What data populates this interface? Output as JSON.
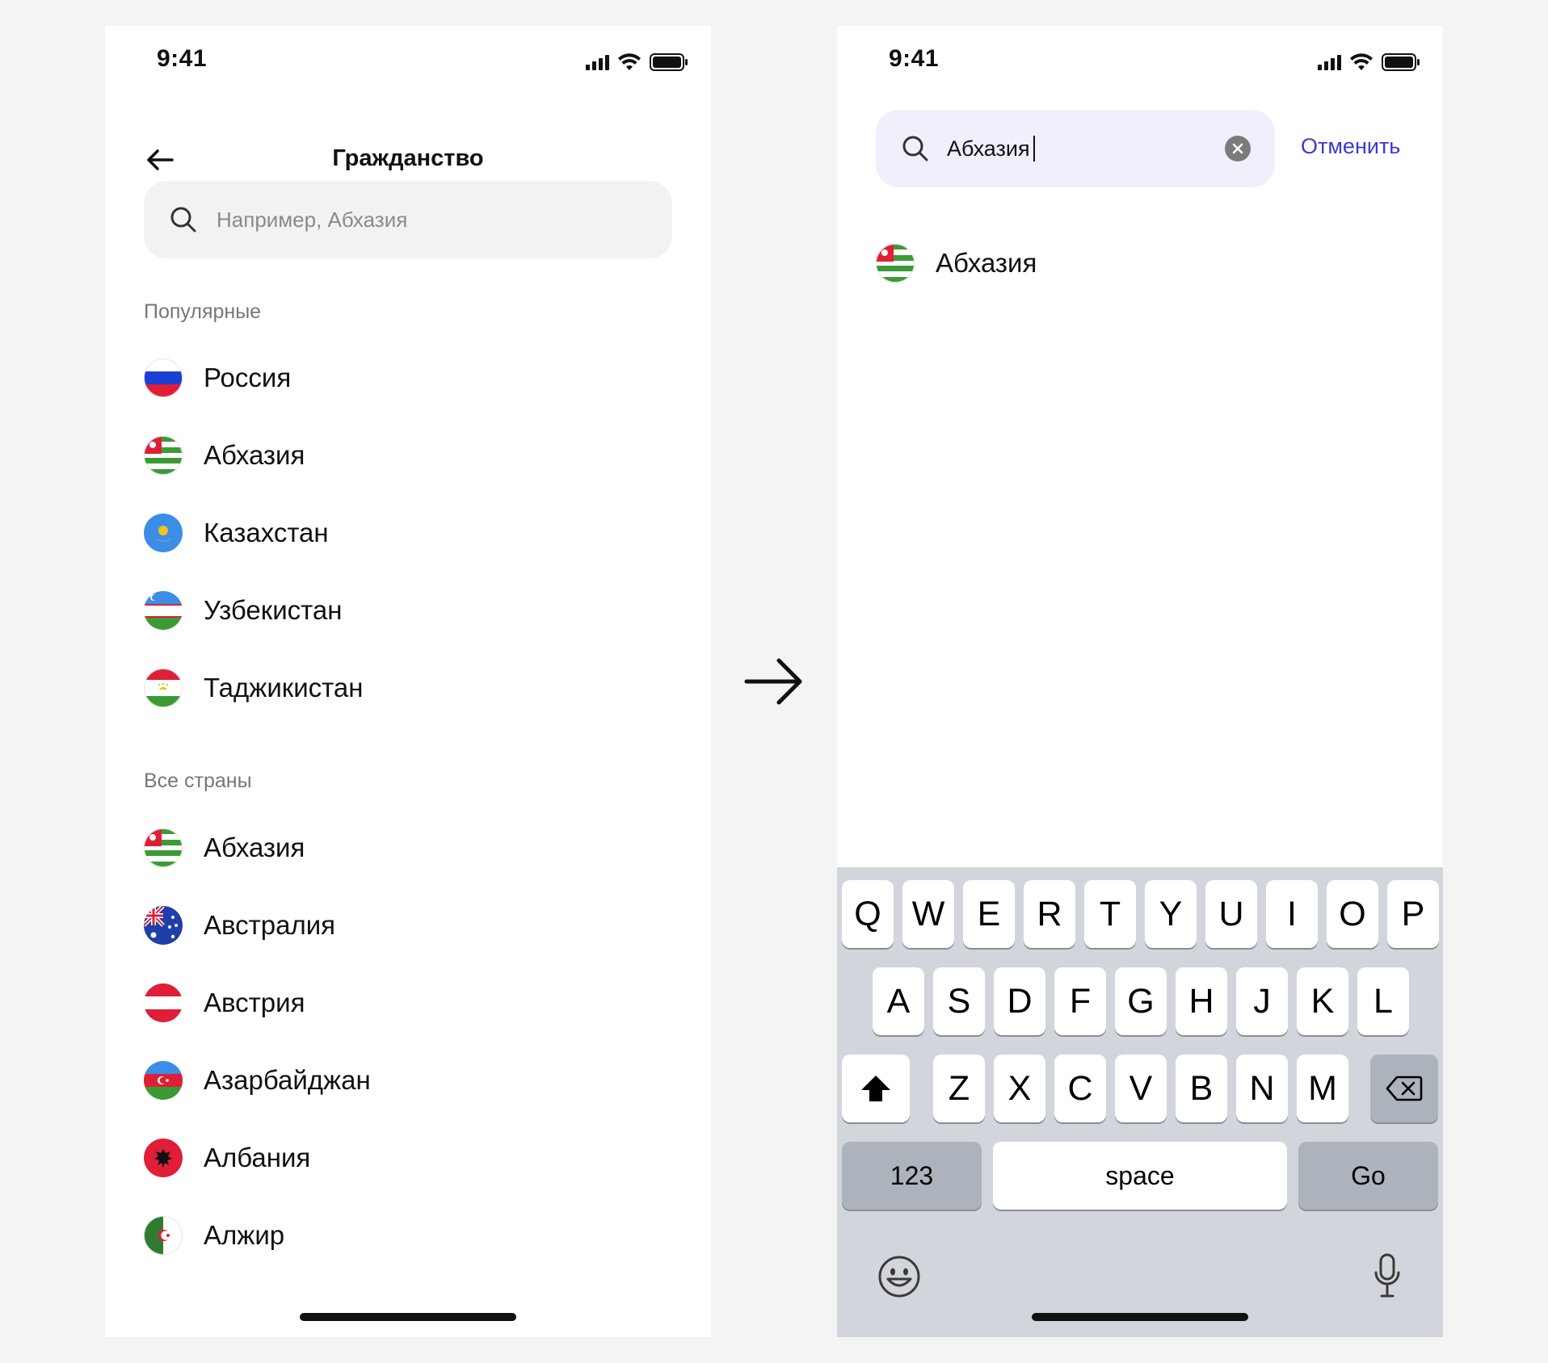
{
  "left_screen": {
    "status": {
      "time": "9:41"
    },
    "header": {
      "title": "Гражданство"
    },
    "search": {
      "placeholder": "Например, Абхазия"
    },
    "popular": {
      "label": "Популярные",
      "items": [
        {
          "label": "Россия",
          "flag": "russia-flag-icon"
        },
        {
          "label": "Абхазия",
          "flag": "abkhazia-flag-icon"
        },
        {
          "label": "Казахстан",
          "flag": "kazakhstan-flag-icon"
        },
        {
          "label": "Узбекистан",
          "flag": "uzbekistan-flag-icon"
        },
        {
          "label": "Таджикистан",
          "flag": "tajikistan-flag-icon"
        }
      ]
    },
    "all": {
      "label": "Все страны",
      "items": [
        {
          "label": "Абхазия",
          "flag": "abkhazia-flag-icon"
        },
        {
          "label": "Австралия",
          "flag": "australia-flag-icon"
        },
        {
          "label": "Австрия",
          "flag": "austria-flag-icon"
        },
        {
          "label": "Азарбайджан",
          "flag": "azerbaijan-flag-icon"
        },
        {
          "label": "Албания",
          "flag": "albania-flag-icon"
        },
        {
          "label": "Алжир",
          "flag": "algeria-flag-icon"
        }
      ]
    }
  },
  "right_screen": {
    "status": {
      "time": "9:41"
    },
    "search": {
      "value": "Абхазия",
      "cancel_label": "Отменить"
    },
    "results": [
      {
        "label": "Абхазия",
        "flag": "abkhazia-flag-icon"
      }
    ],
    "keyboard": {
      "row1": [
        "Q",
        "W",
        "E",
        "R",
        "T",
        "Y",
        "U",
        "I",
        "O",
        "P"
      ],
      "row2": [
        "A",
        "S",
        "D",
        "F",
        "G",
        "H",
        "J",
        "K",
        "L"
      ],
      "row3": [
        "Z",
        "X",
        "C",
        "V",
        "B",
        "N",
        "M"
      ],
      "numbers_label": "123",
      "space_label": "space",
      "go_label": "Go",
      "icons": [
        "shift-icon",
        "backspace-icon",
        "emoji-icon",
        "microphone-icon"
      ]
    }
  },
  "colors": {
    "accent": "#3d3ad1",
    "active_search_bg": "#f1effc",
    "search_bg": "#f2f2f2",
    "keyboard_bg": "#d2d5db"
  }
}
